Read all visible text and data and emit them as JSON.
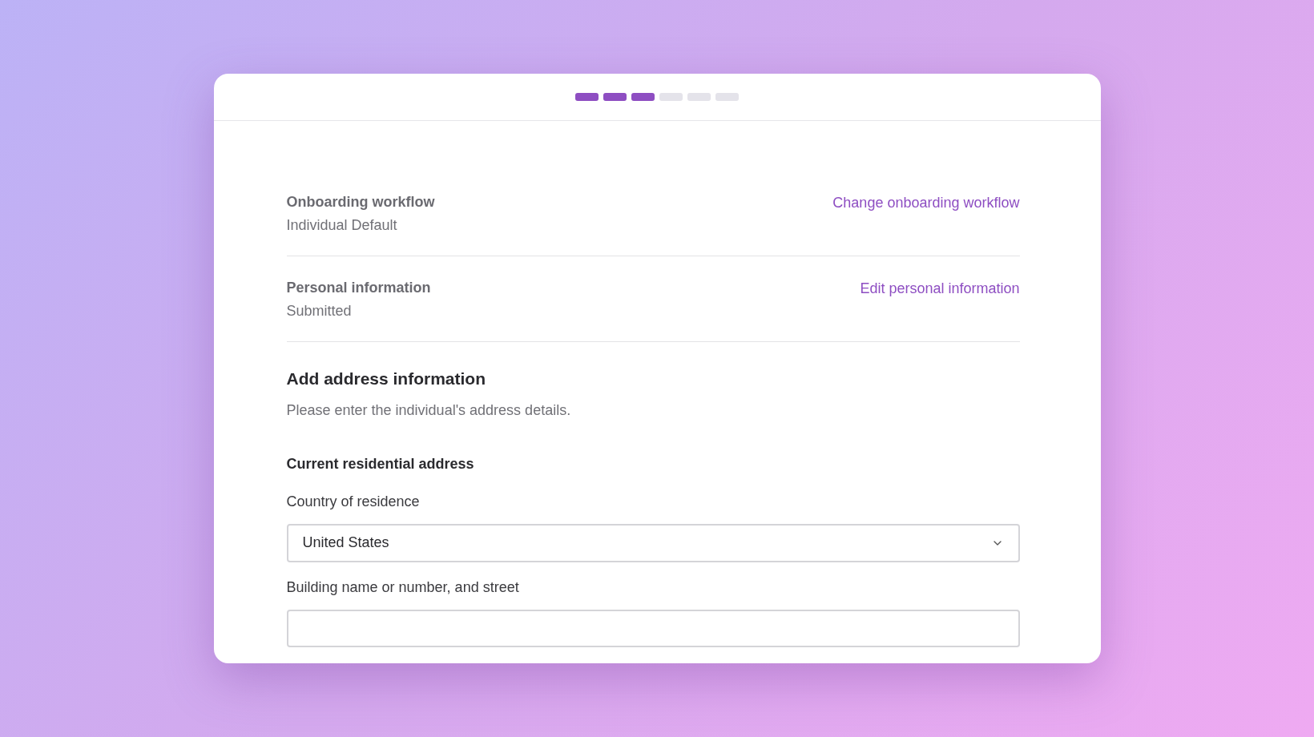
{
  "progress_steps": [
    {
      "completed": true
    },
    {
      "completed": true
    },
    {
      "completed": true
    },
    {
      "completed": false
    },
    {
      "completed": false
    },
    {
      "completed": false
    }
  ],
  "summary_rows": [
    {
      "title": "Onboarding workflow",
      "value": "Individual Default",
      "link": "Change onboarding workflow"
    },
    {
      "title": "Personal information",
      "value": "Submitted",
      "link": "Edit personal information"
    }
  ],
  "section": {
    "heading": "Add address information",
    "description": "Please enter the individual's address details.",
    "subheading": "Current residential address"
  },
  "fields": [
    {
      "kind": "select",
      "label": "Country of residence",
      "value": "United States"
    },
    {
      "kind": "text",
      "label": "Building name or number, and street"
    }
  ]
}
